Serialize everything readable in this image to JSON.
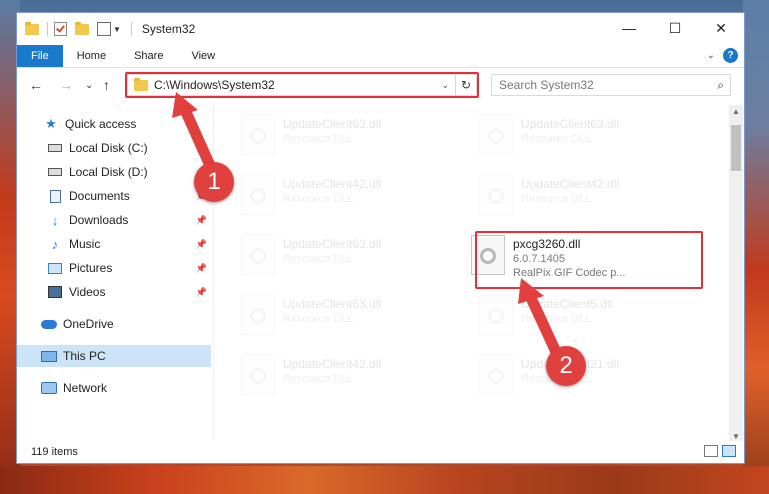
{
  "window": {
    "title": "System32",
    "controls": {
      "minimize": "—",
      "maximize": "☐",
      "close": "✕"
    }
  },
  "ribbon": {
    "tabs": [
      "File",
      "Home",
      "Share",
      "View"
    ],
    "collapse_glyph": "⌄",
    "help_glyph": "?"
  },
  "address": {
    "path": "C:\\Windows\\System32",
    "dropdown_glyph": "⌄",
    "refresh_glyph": "↻",
    "search_placeholder": "Search System32",
    "search_glyph": "⌕"
  },
  "nav": {
    "back": "←",
    "forward": "→",
    "recent": "⌄",
    "up": "↑"
  },
  "sidebar": {
    "items": [
      {
        "label": "Quick access",
        "icon": "star-icon",
        "pinned": false
      },
      {
        "label": "Local Disk (C:)",
        "icon": "disk-icon",
        "pinned": true
      },
      {
        "label": "Local Disk (D:)",
        "icon": "disk-icon",
        "pinned": true
      },
      {
        "label": "Documents",
        "icon": "document-icon",
        "pinned": true
      },
      {
        "label": "Downloads",
        "icon": "download-icon",
        "pinned": true
      },
      {
        "label": "Music",
        "icon": "music-icon",
        "pinned": true
      },
      {
        "label": "Pictures",
        "icon": "pictures-icon",
        "pinned": true
      },
      {
        "label": "Videos",
        "icon": "videos-icon",
        "pinned": true
      },
      {
        "label": "OneDrive",
        "icon": "cloud-icon",
        "pinned": false
      },
      {
        "label": "This PC",
        "icon": "computer-icon",
        "pinned": false,
        "selected": true
      },
      {
        "label": "Network",
        "icon": "network-icon",
        "pinned": false
      }
    ],
    "pin_glyph": "📌"
  },
  "files": {
    "left_column": [
      {
        "name": "UpdateClient63.dll",
        "sub": "Resource DLL"
      },
      {
        "name": "UpdateClient42.dll",
        "sub": "Resource DLL"
      },
      {
        "name": "UpdateClient63.dll",
        "sub": "Resource DLL"
      },
      {
        "name": "UpdateClient63.dll",
        "sub": "Resource DLL"
      },
      {
        "name": "UpdateClient42.dll",
        "sub": "Resource DLL"
      }
    ],
    "right_column": [
      {
        "name": "UpdateClient63.dll",
        "sub": "Resource DLL"
      },
      {
        "name": "UpdateClient42.dll",
        "sub": "Resource DLL"
      },
      {
        "name": "pxcg3260.dll",
        "sub": "6.0.7.1405",
        "sub2": "RealPix GIF Codec p...",
        "highlighted": true
      },
      {
        "name": "UpdateClient5.dll",
        "sub": "Resource DLL"
      },
      {
        "name": "UpdateClient21.dll",
        "sub": "Resource DLL"
      }
    ]
  },
  "status": {
    "item_count": "119 items"
  },
  "annotations": {
    "step1": "1",
    "step2": "2"
  },
  "colors": {
    "accent": "#1979ca",
    "annotation": "#e0303a",
    "selection": "#cce4f7"
  }
}
